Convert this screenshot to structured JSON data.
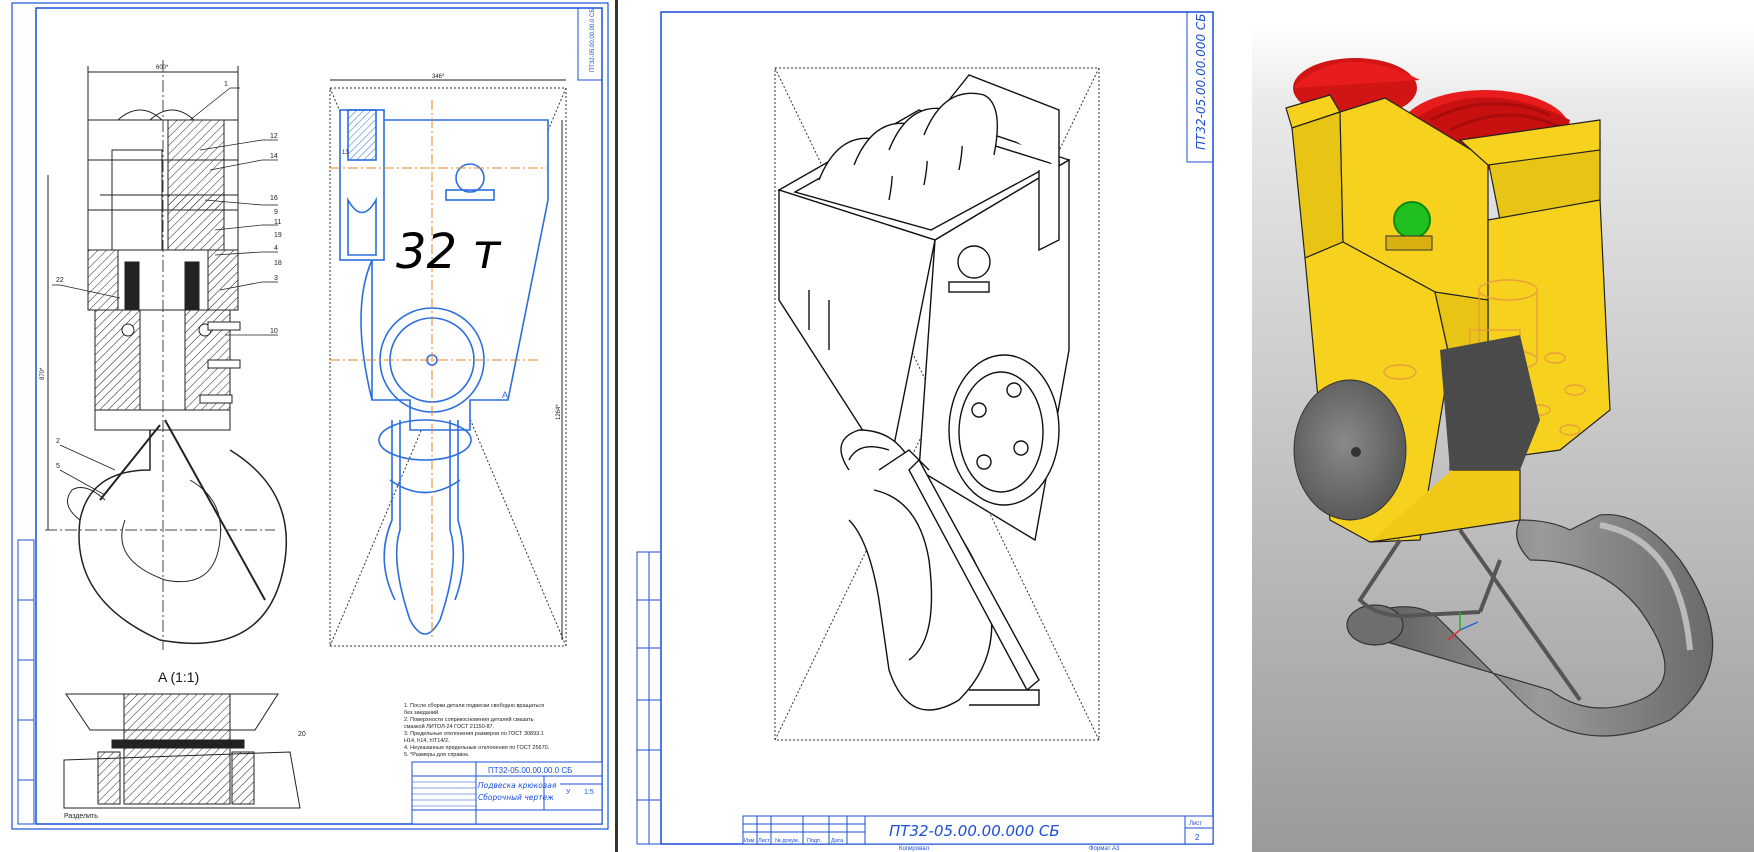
{
  "sheet1": {
    "section_title": "A (1:1)",
    "load_label": "32 т",
    "section_marker": "A",
    "dim_top": "600*",
    "dim_top2": "346*",
    "dim_left": "870*",
    "dim_right": "1264*",
    "doc_code": "ПТ32-05.00.00.00.0 СБ",
    "title_line1": "Подвеска крюковая",
    "title_line2": "Сборочный чертеж",
    "scale": "1:5",
    "stage": "У",
    "bottom_left_label": "Разделить",
    "notes": [
      "1. После сборки детали подвески свободно вращаться",
      "   без заеданий.",
      "2. Поверхности соприкосновения деталей смазать",
      "   смазкой ЛИТОЛ-24 ГОСТ 21150-87.",
      "3. Предельные отклонения размеров по ГОСТ 30893.1",
      "   H14, h14, ±IT14/2.",
      "4. Неуказанные предельные отклонения по ГОСТ 25670.",
      "5. *Размеры для справок."
    ],
    "part_numbers": [
      "1",
      "12",
      "14",
      "13",
      "16",
      "9",
      "11",
      "19",
      "4",
      "18",
      "3",
      "22",
      "10",
      "15",
      "2",
      "5",
      "20",
      "21",
      "7",
      "17"
    ]
  },
  "sheet2": {
    "doc_code": "ПТ32-05.00.00.000 СБ",
    "sheet_label": "Лист",
    "sheet_number": "2",
    "title_block_headers": [
      "Изм",
      "Лист",
      "№ докум.",
      "Подп.",
      "Дата"
    ],
    "footer_left": "Копировал",
    "footer_right": "Формат А3"
  },
  "colors": {
    "frame": "#1a4fd6",
    "blue_drawing": "#2b6ee0",
    "red_sheaves": "#e81c1c",
    "yellow_body": "#f6d21e",
    "green_lube": "#1fc01f",
    "orange_hidden": "#e89a40",
    "gray_hook": "#6f6f6f"
  }
}
